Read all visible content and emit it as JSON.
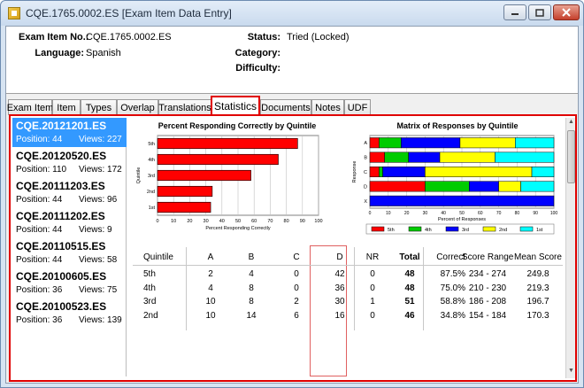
{
  "window": {
    "title": "CQE.1765.0002.ES [Exam Item Data Entry]"
  },
  "header": {
    "exam_item_label": "Exam Item No.:",
    "exam_item_value": "CQE.1765.0002.ES",
    "language_label": "Language:",
    "language_value": "Spanish",
    "status_label": "Status:",
    "status_value": "Tried (Locked)",
    "category_label": "Category:",
    "category_value": "",
    "difficulty_label": "Difficulty:",
    "difficulty_value": ""
  },
  "tabs": [
    "Exam Item",
    "Item",
    "Types",
    "Overlap",
    "Translations",
    "Statistics",
    "Documents",
    "Notes",
    "UDF"
  ],
  "active_tab": "Statistics",
  "items": [
    {
      "code": "CQE.20121201.ES",
      "position": "Position: 44",
      "views": "Views: 227",
      "selected": true
    },
    {
      "code": "CQE.20120520.ES",
      "position": "Position: 110",
      "views": "Views: 172"
    },
    {
      "code": "CQE.20111203.ES",
      "position": "Position: 44",
      "views": "Views: 96"
    },
    {
      "code": "CQE.20111202.ES",
      "position": "Position: 44",
      "views": "Views: 9"
    },
    {
      "code": "CQE.20110515.ES",
      "position": "Position: 44",
      "views": "Views: 58"
    },
    {
      "code": "CQE.20100605.ES",
      "position": "Position: 36",
      "views": "Views: 75"
    },
    {
      "code": "CQE.20100523.ES",
      "position": "Position: 36",
      "views": "Views: 139"
    }
  ],
  "colors": {
    "highlight_red": "#e00000",
    "selection_blue": "#3399ff",
    "bar_red": "#ff0000",
    "q5": "#ff0000",
    "q4": "#00cc00",
    "q3": "#0000ff",
    "q2": "#ffff00",
    "q1": "#00ffff"
  },
  "chart_data": [
    {
      "type": "bar",
      "orientation": "horizontal",
      "title": "Percent Responding Correctly by Quintile",
      "xlabel": "Percent Responding Correctly",
      "ylabel": "Quintile",
      "categories": [
        "5th",
        "4th",
        "3rd",
        "2nd",
        "1st"
      ],
      "values": [
        87,
        75,
        58,
        34,
        33
      ],
      "xlim": [
        0,
        100
      ],
      "xticks": [
        0,
        10,
        20,
        30,
        40,
        50,
        60,
        70,
        80,
        90,
        100
      ],
      "grid": true
    },
    {
      "type": "bar",
      "orientation": "horizontal",
      "stacked": true,
      "title": "Matrix of Responses by Quintile",
      "xlabel": "Percent of Responses",
      "ylabel": "Response",
      "categories": [
        "A",
        "B",
        "C",
        "D",
        "X"
      ],
      "xlim": [
        0,
        100
      ],
      "xticks": [
        0,
        10,
        20,
        30,
        40,
        50,
        60,
        70,
        80,
        90,
        100
      ],
      "legend_position": "bottom",
      "series": [
        {
          "name": "5th",
          "values": [
            5,
            8,
            5,
            30,
            0
          ]
        },
        {
          "name": "4th",
          "values": [
            12,
            13,
            2,
            24,
            0
          ]
        },
        {
          "name": "3rd",
          "values": [
            32,
            17,
            23,
            16,
            100
          ]
        },
        {
          "name": "2nd",
          "values": [
            30,
            30,
            58,
            12,
            0
          ]
        },
        {
          "name": "1st",
          "values": [
            21,
            32,
            12,
            18,
            0
          ]
        }
      ]
    }
  ],
  "stats_table": {
    "headers": [
      "Quintile",
      "A",
      "B",
      "C",
      "D",
      "NR",
      "Total",
      "Correct",
      "Score Range",
      "Mean Score"
    ],
    "rows": [
      [
        "5th",
        "2",
        "4",
        "0",
        "42",
        "0",
        "48",
        "87.5%",
        "234 - 274",
        "249.8"
      ],
      [
        "4th",
        "4",
        "8",
        "0",
        "36",
        "0",
        "48",
        "75.0%",
        "210 - 230",
        "219.3"
      ],
      [
        "3rd",
        "10",
        "8",
        "2",
        "30",
        "1",
        "51",
        "58.8%",
        "186 - 208",
        "196.7"
      ],
      [
        "2nd",
        "10",
        "14",
        "6",
        "16",
        "0",
        "46",
        "34.8%",
        "154 - 184",
        "170.3"
      ]
    ]
  }
}
